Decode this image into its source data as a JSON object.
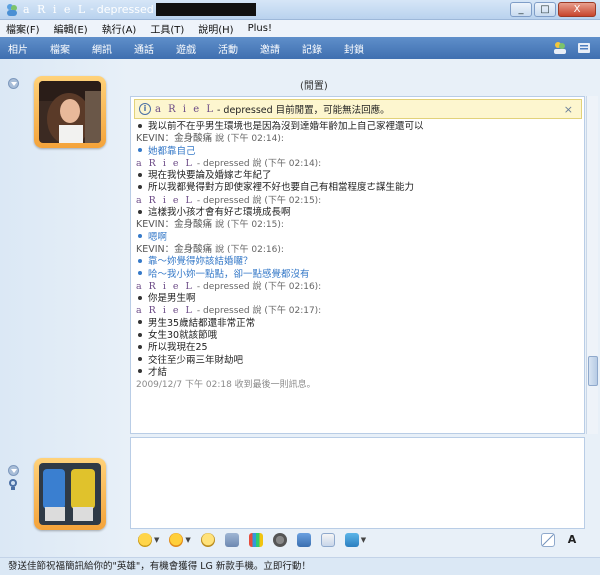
{
  "window": {
    "title_name": "a R i e L",
    "title_sep": "-",
    "title_status": "depressed",
    "buttons": [
      "_",
      "□",
      "X"
    ]
  },
  "menu": [
    "檔案(F)",
    "編輯(E)",
    "執行(A)",
    "工具(T)",
    "說明(H)",
    "Plus!"
  ],
  "toolbar": [
    "相片",
    "檔案",
    "網訊",
    "通話",
    "遊戲",
    "活動",
    "邀請",
    "記錄",
    "封鎖"
  ],
  "chat": {
    "contact_header": "(閒置)",
    "notice": {
      "name": "a R i e L",
      "text": "- depressed 目前閒置，可能無法回應。",
      "close": "×"
    },
    "lines": [
      {
        "kind": "msg",
        "text": "我以前不在乎男生環境也是因為沒到達婚年齡加上自己家裡還可以",
        "blue": false
      },
      {
        "kind": "sender",
        "name": "KEVIN：金身酸痛",
        "says": "說 (下午 02:14):"
      },
      {
        "kind": "msg",
        "text": "她都靠自己",
        "blue": true
      },
      {
        "kind": "sender",
        "name": "a R i e L",
        "says": "- depressed 說 (下午 02:14):"
      },
      {
        "kind": "msg",
        "text": "現在我快要論及婚嫁ㄜ年紀了",
        "blue": false
      },
      {
        "kind": "msg",
        "text": "所以我都覺得對方即使家裡不好也要自己有相當程度ㄜ謀生能力",
        "blue": false
      },
      {
        "kind": "sender",
        "name": "a R i e L",
        "says": "- depressed 說 (下午 02:15):"
      },
      {
        "kind": "msg",
        "text": "這樣我小孩才會有好ㄜ環境成長啊",
        "blue": false
      },
      {
        "kind": "sender",
        "name": "KEVIN：金身酸痛",
        "says": "說 (下午 02:15):"
      },
      {
        "kind": "msg",
        "text": "嗯啊",
        "blue": true
      },
      {
        "kind": "sender",
        "name": "KEVIN：金身酸痛",
        "says": "說 (下午 02:16):"
      },
      {
        "kind": "msg",
        "text": "靠～妳覺得妳該結婚囉？",
        "blue": true
      },
      {
        "kind": "msg",
        "text": "哈～我小妳一點點，卻一點感覺都沒有",
        "blue": true
      },
      {
        "kind": "sender",
        "name": "a R i e L",
        "says": "- depressed 說 (下午 02:16):"
      },
      {
        "kind": "msg",
        "text": "你是男生啊",
        "blue": false
      },
      {
        "kind": "sender",
        "name": "a R i e L",
        "says": "- depressed 說 (下午 02:17):"
      },
      {
        "kind": "msg",
        "text": "男生35歲結都還非常正常",
        "blue": false
      },
      {
        "kind": "msg",
        "text": "女生30就該節哦",
        "blue": false
      },
      {
        "kind": "msg",
        "text": "所以我現在25",
        "blue": false
      },
      {
        "kind": "msg",
        "text": "交往至少兩三年財劫吧",
        "blue": false
      },
      {
        "kind": "msg",
        "text": "才結",
        "blue": false
      },
      {
        "kind": "stamp",
        "text": "2009/12/7 下午 02:18 收到最後一則訊息。"
      }
    ]
  },
  "statusbar": "發送佳節祝福簡訊給你的\"英雄\"，有機會獲得 LG 新款手機。立即行動！",
  "colors": {
    "toolbar": "#4f7fc0",
    "accent_blue": "#3579c8",
    "name_purple": "#6b4a86",
    "avatar_frame": "#f4a33a"
  },
  "scroll_fraction": 0.85
}
